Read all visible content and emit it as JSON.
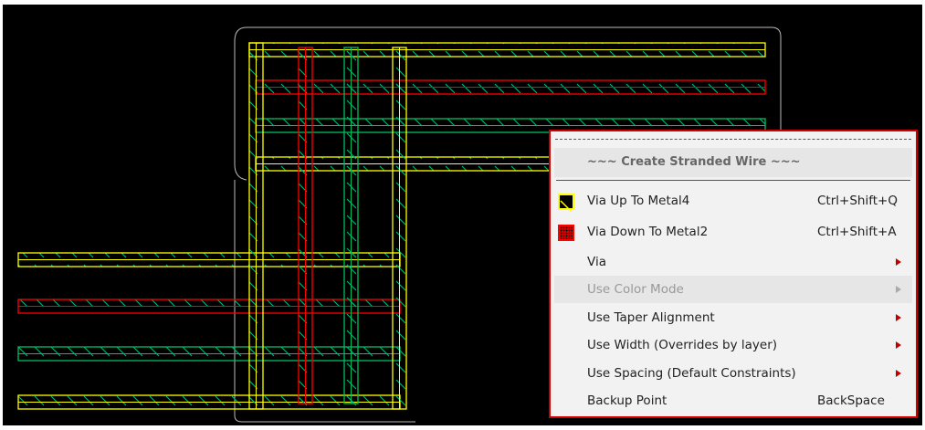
{
  "colors": {
    "yellow": "#ffff00",
    "red": "#ff0000",
    "green": "#00c060",
    "menu_border": "#d00000"
  },
  "menu": {
    "title": "~~~ Create Stranded Wire ~~~",
    "items": [
      {
        "label": "Via Up To Metal4",
        "shortcut": "Ctrl+Shift+Q",
        "icon": "via-up-metal4-icon"
      },
      {
        "label": "Via Down To Metal2",
        "shortcut": "Ctrl+Shift+A",
        "icon": "via-down-metal2-icon"
      },
      {
        "label": "Via",
        "submenu": true
      },
      {
        "label": "Use Color Mode",
        "submenu": true,
        "disabled": true
      },
      {
        "label": "Use Taper Alignment",
        "submenu": true
      },
      {
        "label": "Use Width (Overrides by layer)",
        "submenu": true
      },
      {
        "label": "Use Spacing (Default Constraints)",
        "submenu": true
      },
      {
        "label": "Backup Point",
        "shortcut": "BackSpace"
      }
    ]
  }
}
